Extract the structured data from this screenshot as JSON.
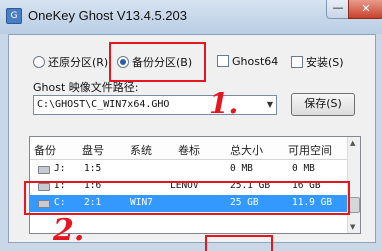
{
  "window": {
    "title": "OneKey Ghost V13.4.5.203",
    "minimize_glyph": "—",
    "close_glyph": "✕"
  },
  "options": {
    "restore_label": "还原分区(R)",
    "backup_label": "备份分区(B)",
    "ghost64_label": "Ghost64",
    "install_label": "安装(S)",
    "selected": "backup"
  },
  "path": {
    "label": "Ghost 映像文件路径:",
    "value": "C:\\GHOST\\C_WIN7x64.GHO"
  },
  "save_label": "保存(S)",
  "table": {
    "headers": [
      "备份",
      "盘号",
      "系统",
      "卷标",
      "总大小",
      "可用空间"
    ],
    "rows": [
      {
        "drive": "J:",
        "disk": "1:5",
        "system": "",
        "volume": "",
        "total": "0 MB",
        "free": "0 MB"
      },
      {
        "drive": "I:",
        "disk": "1:6",
        "system": "",
        "volume": "LENOV",
        "total": "25.1 GB",
        "free": "16 GB"
      },
      {
        "drive": "C:",
        "disk": "2:1",
        "system": "WIN7",
        "volume": "",
        "total": "25 GB",
        "free": "11.9 GB"
      }
    ],
    "selected_row": 2
  },
  "annotations": {
    "mark_1": "1.",
    "mark_2": "2."
  },
  "colors": {
    "annotation_red": "#e5161f",
    "selection_blue": "#3399ff"
  }
}
